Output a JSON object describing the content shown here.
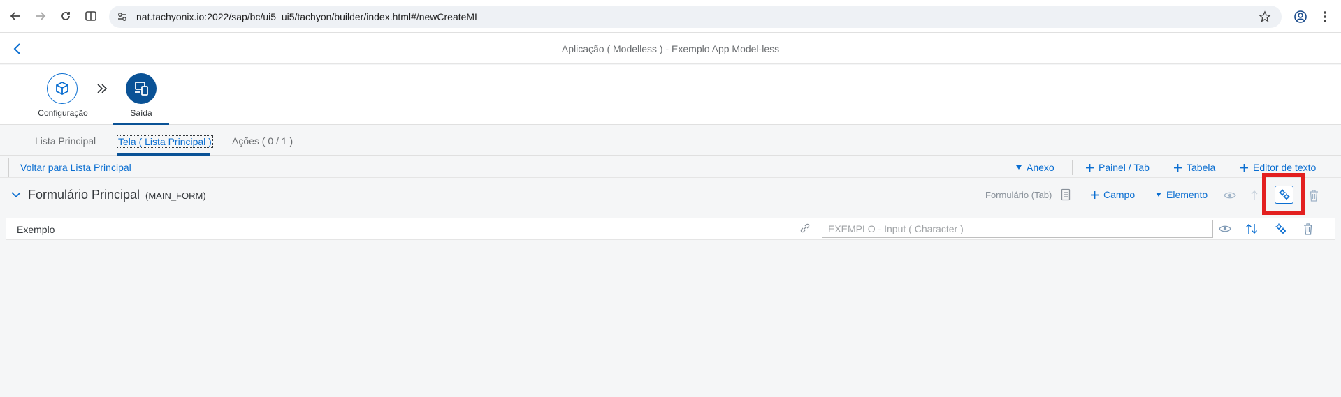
{
  "browser": {
    "url": "nat.tachyonix.io:2022/sap/bc/ui5_ui5/tachyon/builder/index.html#/newCreateML"
  },
  "header": {
    "title": "Aplicação ( Modelless ) - Exemplo App Model-less"
  },
  "wizard": {
    "steps": [
      {
        "label": "Configuração",
        "icon": "package-icon",
        "active": false
      },
      {
        "label": "Saída",
        "icon": "devices-icon",
        "active": true
      }
    ]
  },
  "tabs": [
    {
      "label": "Lista Principal",
      "selected": false
    },
    {
      "label": "Tela ( Lista Principal )",
      "selected": true
    },
    {
      "label": "Ações ( 0 / 1 )",
      "selected": false
    }
  ],
  "toolbar": {
    "back_link": "Voltar para Lista Principal",
    "anexo": "Anexo",
    "painel_tab": "Painel / Tab",
    "tabela": "Tabela",
    "editor_texto": "Editor de texto"
  },
  "form": {
    "title": "Formulário Principal",
    "id": "(MAIN_FORM)",
    "form_type": "Formulário (Tab)",
    "campo": "Campo",
    "elemento": "Elemento"
  },
  "field": {
    "label": "Exemplo",
    "placeholder": "EXEMPLO - Input ( Character )",
    "value": ""
  },
  "colors": {
    "accent": "#0a6ed1",
    "wizard_active": "#0a5296",
    "highlight": "#e32020"
  }
}
